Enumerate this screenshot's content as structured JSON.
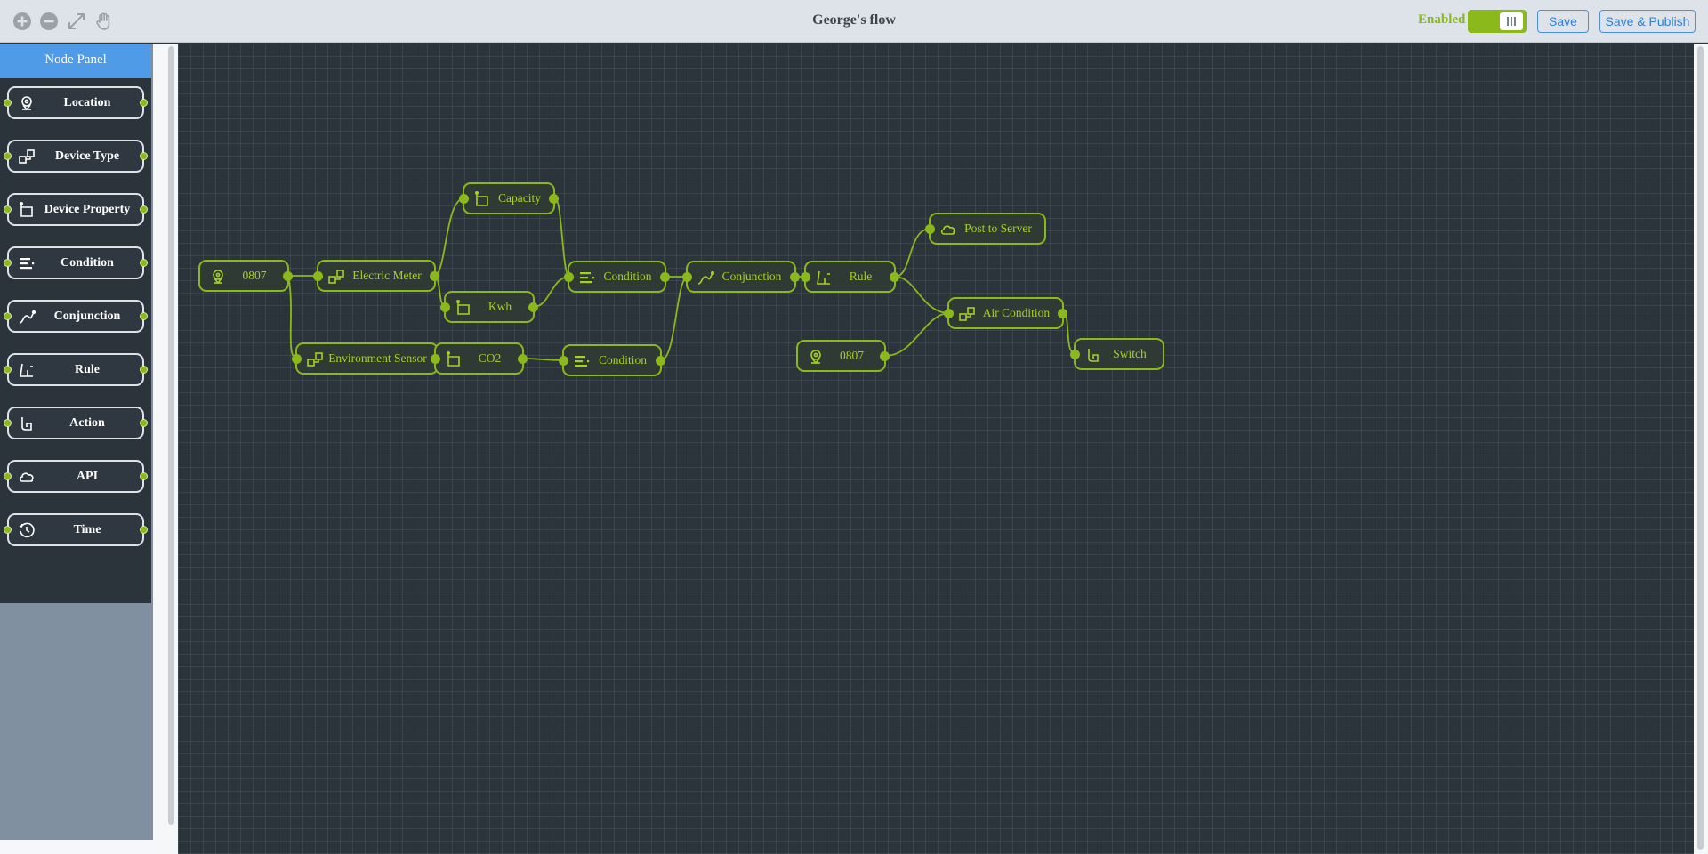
{
  "title": "George's flow",
  "toolbar": {
    "tools": [
      "zoom-in-icon",
      "zoom-out-icon",
      "fit-screen-icon",
      "pan-hand-icon"
    ],
    "enabled_label": "Enabled",
    "enabled": true,
    "save_label": "Save",
    "publish_label": "Save & Publish"
  },
  "node_panel": {
    "header": "Node Panel",
    "items": [
      {
        "label": "Location",
        "icon": "location-icon"
      },
      {
        "label": "Device Type",
        "icon": "device-type-icon"
      },
      {
        "label": "Device Property",
        "icon": "device-property-icon"
      },
      {
        "label": "Condition",
        "icon": "condition-icon"
      },
      {
        "label": "Conjunction",
        "icon": "conjunction-icon"
      },
      {
        "label": "Rule",
        "icon": "rule-icon"
      },
      {
        "label": "Action",
        "icon": "action-icon"
      },
      {
        "label": "API",
        "icon": "api-icon"
      },
      {
        "label": "Time",
        "icon": "time-icon"
      }
    ]
  },
  "flow": {
    "nodes": [
      {
        "id": "n1",
        "label": "0807",
        "type": "location"
      },
      {
        "id": "n2",
        "label": "Electric Meter",
        "type": "device-type"
      },
      {
        "id": "n3",
        "label": "Environment Sensor",
        "type": "device-type"
      },
      {
        "id": "n4",
        "label": "Capacity",
        "type": "device-property"
      },
      {
        "id": "n5",
        "label": "Kwh",
        "type": "device-property"
      },
      {
        "id": "n6",
        "label": "CO2",
        "type": "device-property"
      },
      {
        "id": "n7",
        "label": "Condition",
        "type": "condition"
      },
      {
        "id": "n8",
        "label": "Condition",
        "type": "condition"
      },
      {
        "id": "n9",
        "label": "Conjunction",
        "type": "conjunction"
      },
      {
        "id": "n10",
        "label": "Rule",
        "type": "rule"
      },
      {
        "id": "n11",
        "label": "Post to Server",
        "type": "api"
      },
      {
        "id": "n12",
        "label": "Air Condition",
        "type": "device-type"
      },
      {
        "id": "n13",
        "label": "0807",
        "type": "location"
      },
      {
        "id": "n14",
        "label": "Switch",
        "type": "action"
      }
    ],
    "links": [
      [
        "n1",
        "n2"
      ],
      [
        "n1",
        "n3"
      ],
      [
        "n2",
        "n4"
      ],
      [
        "n2",
        "n5"
      ],
      [
        "n3",
        "n6"
      ],
      [
        "n4",
        "n7"
      ],
      [
        "n5",
        "n7"
      ],
      [
        "n6",
        "n8"
      ],
      [
        "n7",
        "n9"
      ],
      [
        "n8",
        "n9"
      ],
      [
        "n9",
        "n10"
      ],
      [
        "n10",
        "n11"
      ],
      [
        "n10",
        "n12"
      ],
      [
        "n13",
        "n12"
      ],
      [
        "n12",
        "n14"
      ]
    ]
  },
  "colors": {
    "accent": "#8bb81a",
    "canvas": "#2c343b",
    "panel_header": "#4f9be8",
    "button_blue": "#2f7ed8"
  }
}
